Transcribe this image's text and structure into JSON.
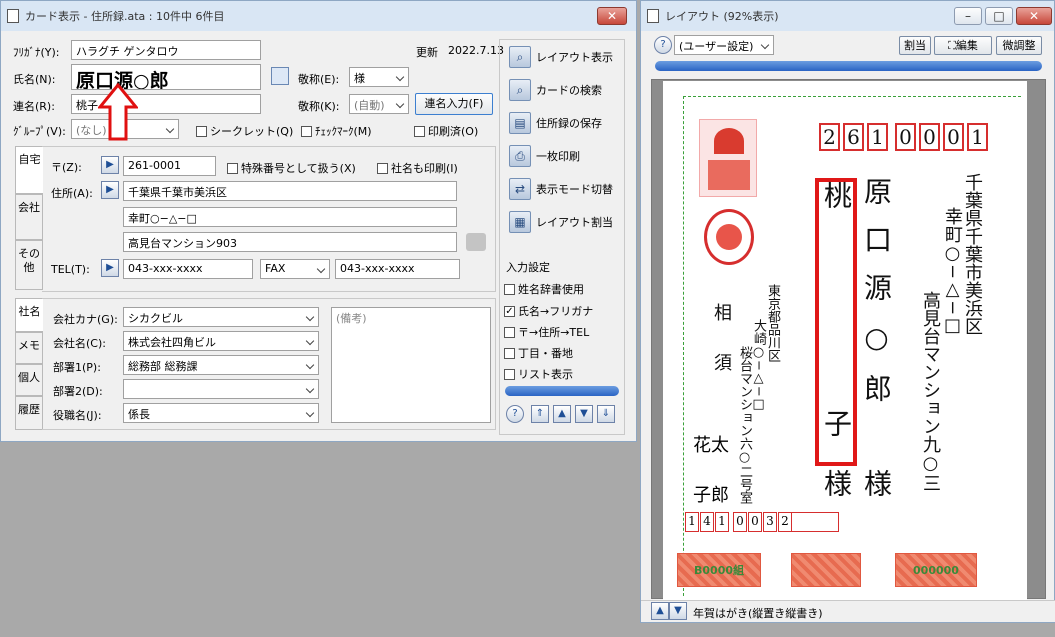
{
  "left_window": {
    "title": "カード表示 - 住所録.ata : 10件中 6件目",
    "close": "✕"
  },
  "right_window": {
    "title": "レイアウト (92%表示)",
    "min": "–",
    "max": "□",
    "close": "✕"
  },
  "card": {
    "furigana_label": "ﾌﾘｶﾞﾅ(Y):",
    "furigana_value": "ハラグチ ゲンタロウ",
    "update_label": "更新",
    "update_date": "2022.7.13",
    "name_label": "氏名(N):",
    "name_value": "原口源○郎",
    "honor_label": "敬称(E):",
    "honor_value": "様",
    "joint_label": "連名(R):",
    "joint_value": "桃子",
    "honor2_label": "敬称(K):",
    "honor2_value": "(自動)",
    "joint_input_button": "連名入力(F)",
    "group_label": "ｸﾞﾙｰﾌﾟ(V):",
    "group_value": "(なし)",
    "secret": "シークレット(Q)",
    "checkmark": "ﾁｪｯｸﾏｰｸ(M)",
    "printed": "印刷済(O)"
  },
  "tabs_home": {
    "tab1": "自宅",
    "tab2": "会社",
    "tab3": "その他"
  },
  "home": {
    "zip_label": "〒(Z):",
    "zip_value": "261-0001",
    "special_num": "特殊番号として扱う(X)",
    "company_print": "社名も印刷(I)",
    "addr_label": "住所(A):",
    "addr1": "千葉県千葉市美浜区",
    "addr2": "幸町○−△−□",
    "addr3": "高見台マンション903",
    "tel_label": "TEL(T):",
    "tel_value": "043-xxx-xxxx",
    "fax_select": "FAX",
    "fax_value": "043-xxx-xxxx"
  },
  "tabs_company": {
    "tab1": "社名",
    "tab2": "メモ",
    "tab3": "個人",
    "tab4": "履歴"
  },
  "company": {
    "kana_label": "会社カナ(G):",
    "kana_value": "シカクビル",
    "name_label": "会社名(C):",
    "name_value": "株式会社四角ビル",
    "dept1_label": "部署1(P):",
    "dept1_value": "総務部 総務課",
    "dept2_label": "部署2(D):",
    "dept2_value": "",
    "title_label": "役職名(J):",
    "title_value": "係長",
    "notes_placeholder": "(備考)"
  },
  "actions": {
    "layout_show": "レイアウト表示",
    "card_search": "カードの検索",
    "save_book": "住所録の保存",
    "print_one": "一枚印刷",
    "mode_switch": "表示モード切替",
    "layout_assign": "レイアウト割当"
  },
  "input_settings": {
    "title": "入力設定",
    "o1": "姓名辞書使用",
    "o2": "氏名→フリガナ",
    "o3": "〒→住所→TEL",
    "o4": "丁目・番地",
    "o5": "リスト表示",
    "o2_checked": true
  },
  "layout_toolbar": {
    "help": "?",
    "user_setting": "(ユーザー設定)",
    "assign": "割当",
    "edit": "編集",
    "adjust": "微調整"
  },
  "postcard": {
    "zip_digits": [
      "2",
      "6",
      "1",
      "0",
      "0",
      "0",
      "1"
    ],
    "addr_line1": "千葉県千葉市美浜区",
    "addr_line2": "幸町○−△−□",
    "addr_line3": "高見台マンション九○三",
    "name_main": "原口源○郎",
    "name_main_suffix": "様",
    "name_joint": "桃子",
    "name_joint_suffix": "様",
    "sender_addr1": "東京都品川区",
    "sender_addr2": "大崎○−△−□",
    "sender_addr3": "桜台マンション六○二号室",
    "sender_name1": "相",
    "sender_name2": "須",
    "sender_name3": "花太",
    "sender_name4": "子郎",
    "sender_zip": [
      "1",
      "4",
      "1",
      "0",
      "0",
      "3",
      "2"
    ],
    "stamp_left": "B0000組",
    "stamp_right": "000000"
  },
  "status": {
    "postcard_type": "年賀はがき(縦置き縦書き)"
  }
}
